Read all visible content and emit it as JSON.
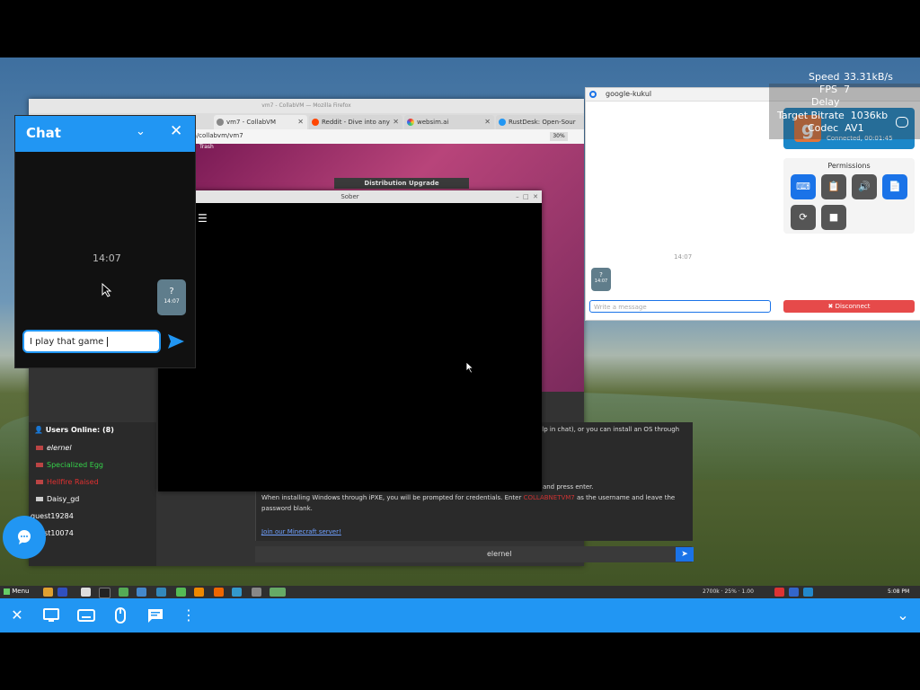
{
  "stats": {
    "speed_label": "Speed",
    "speed_value": "33.31kB/s",
    "fps_label": "FPS",
    "fps_value": "7",
    "delay_label": "Delay",
    "bitrate_label": "Target Bitrate",
    "bitrate_value": "1036kb",
    "codec_label": "Codec",
    "codec_value": "AV1"
  },
  "chat": {
    "title": "Chat",
    "time": "14:07",
    "message": "?",
    "message_time": "14:07",
    "input_value": "I play that game "
  },
  "browser": {
    "title": "vm7 - CollabVM — Mozilla Firefox",
    "tabs": [
      {
        "label": "vm7 - CollabVM"
      },
      {
        "label": "Reddit - Dive into any"
      },
      {
        "label": "websim.ai"
      },
      {
        "label": "RustDesk: Open-Sour"
      }
    ],
    "url": "m/collabvm/vm7",
    "zoom": "30%",
    "trash_label": "Trash",
    "dist_upgrade": "Distribution Upgrade",
    "users_header": "Users Online: (8)",
    "users": [
      {
        "name": "elernel",
        "color": "#ffffff",
        "italic": true
      },
      {
        "name": "Specialized Egg",
        "color": "#35d24a",
        "italic": false
      },
      {
        "name": "Hellfire Raised",
        "color": "#e03030",
        "italic": false
      },
      {
        "name": "Daisy_gd",
        "color": "#ffffff",
        "italic": false
      },
      {
        "name": "guest19284",
        "color": "#ffffff",
        "italic": false
      },
      {
        "name": "guest10074",
        "color": "#ffffff",
        "italic": false
      }
    ],
    "text_line1": "elp in chat), or you can install an OS through",
    "text_line2": ") and press enter.",
    "text_line3a": "When installing Windows through iPXE, you will be prompted for credentials. Enter ",
    "text_line3b": "COLLABNETVM7",
    "text_line3c": " as the username and leave the",
    "text_line4": "password blank.",
    "mc_link": "Join our Minecraft server!",
    "chat_input": "elernel"
  },
  "sober": {
    "title": "Sober",
    "menu_glyph": "☰"
  },
  "remote_panel": {
    "title": "google-kukul",
    "avatar_letter": "g",
    "connected_text": "Connected, 00:01:45",
    "permissions_title": "Permissions",
    "time": "14:07",
    "message": "?",
    "message_time": "14:07",
    "input_placeholder": "Write a message",
    "disconnect_label": "Disconnect"
  },
  "taskbar": {
    "menu_label": "Menu",
    "tray_text": "2700k · 25% · 1.00",
    "clock": "5:08 PM"
  },
  "colors": {
    "accent": "#2196f3",
    "disconnect": "#e64a4a",
    "active_permission": "#1a73e8"
  }
}
